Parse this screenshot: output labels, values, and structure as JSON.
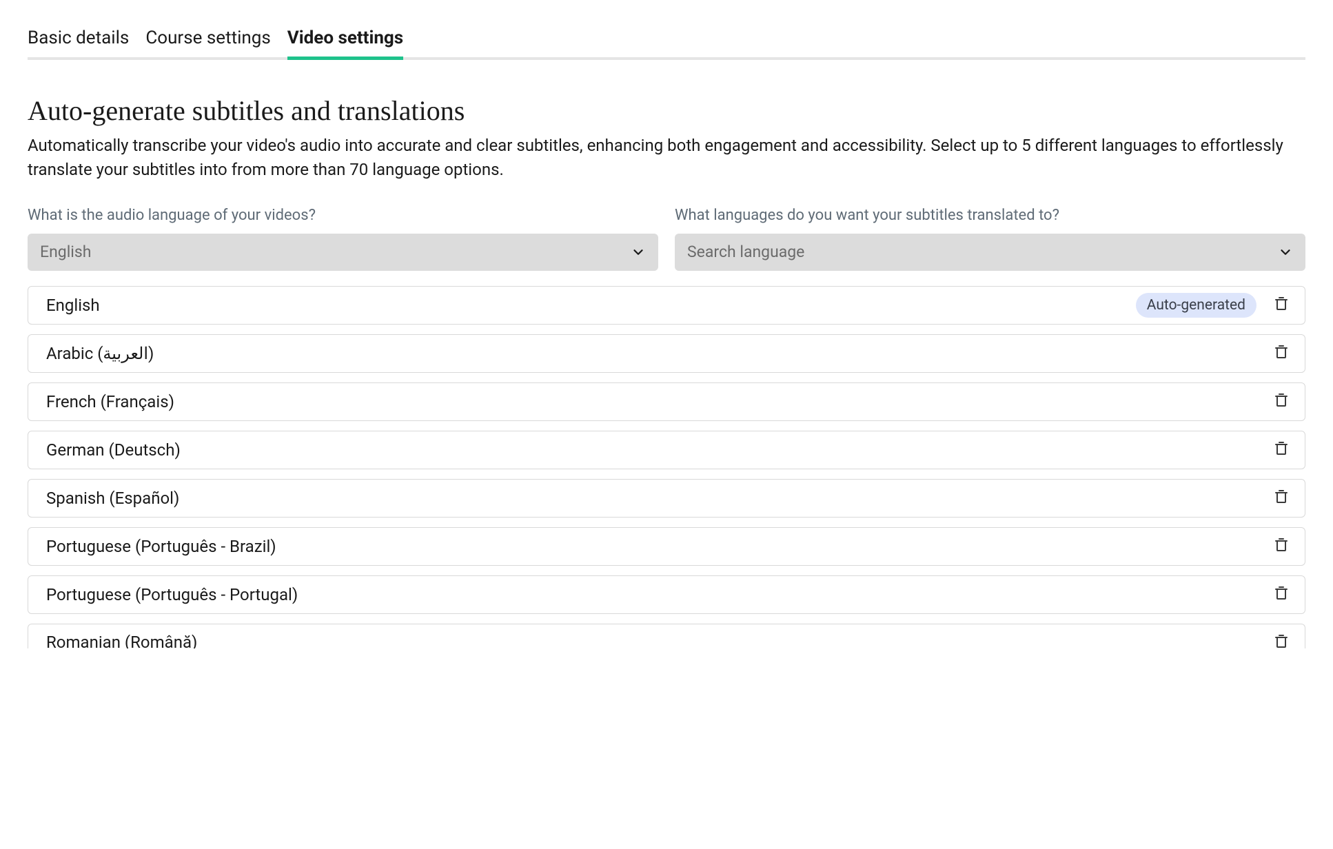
{
  "tabs": {
    "basic": "Basic details",
    "course": "Course settings",
    "video": "Video settings"
  },
  "title": "Auto-generate subtitles and translations",
  "description": "Automatically transcribe your video's audio into accurate and clear subtitles, enhancing both engagement and accessibility. Select up to 5 different languages to effortlessly translate your subtitles into from more than 70 language options.",
  "audioLang": {
    "label": "What is the audio language of your videos?",
    "value": "English"
  },
  "translateTo": {
    "label": "What languages do you want your subtitles translated to?",
    "placeholder": "Search language"
  },
  "badge": "Auto-generated",
  "languages": [
    {
      "name": "English",
      "auto": true
    },
    {
      "name": "Arabic (العربية)",
      "auto": false
    },
    {
      "name": "French (Français)",
      "auto": false
    },
    {
      "name": "German (Deutsch)",
      "auto": false
    },
    {
      "name": "Spanish (Español)",
      "auto": false
    },
    {
      "name": "Portuguese (Português - Brazil)",
      "auto": false
    },
    {
      "name": "Portuguese (Português - Portugal)",
      "auto": false
    },
    {
      "name": "Romanian (Română)",
      "auto": false
    }
  ]
}
